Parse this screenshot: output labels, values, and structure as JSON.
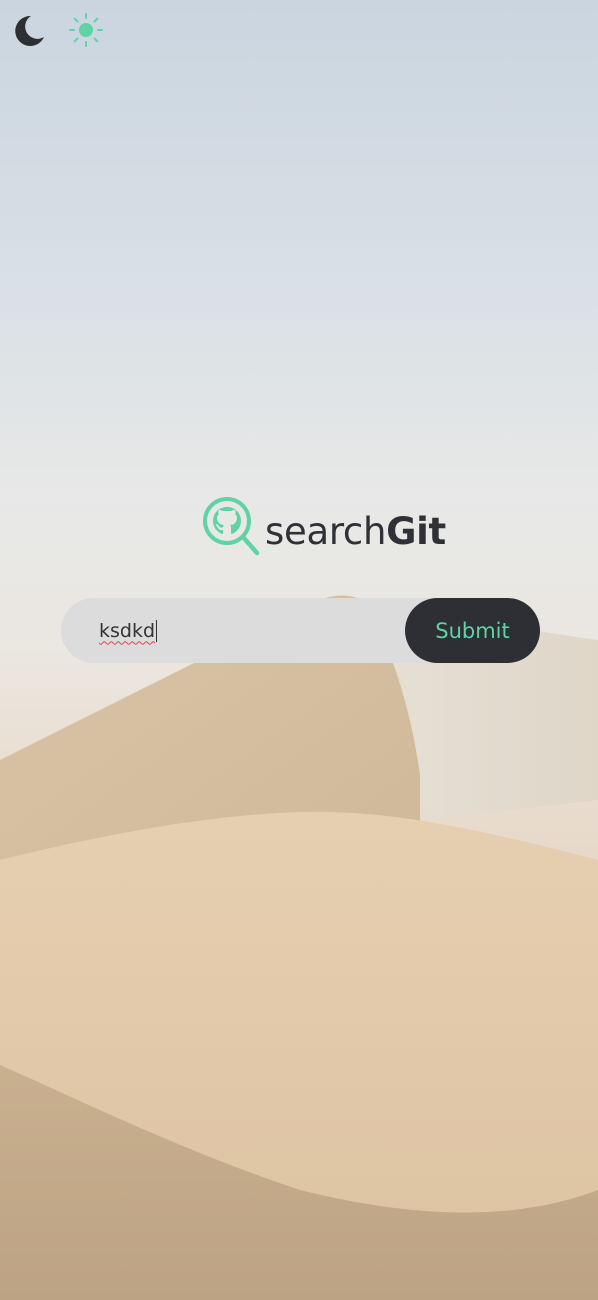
{
  "theme_toggle": {
    "dark_icon": "moon-icon",
    "light_icon": "sun-icon",
    "active": "light",
    "accent_color": "#5fd3a3",
    "dark_color": "#2d2f34"
  },
  "logo": {
    "icon": "search-github-icon",
    "text_light": "search",
    "text_bold": "Git"
  },
  "search": {
    "value": "ksdkd",
    "spellcheck_error": true
  },
  "submit": {
    "label": "Submit"
  }
}
